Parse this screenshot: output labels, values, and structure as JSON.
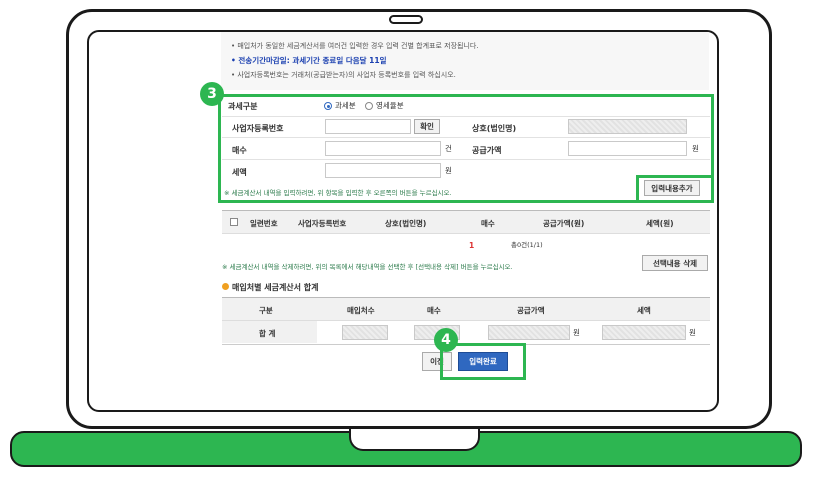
{
  "notes": {
    "line1": "• 매입처가 동일한 세금계산서를 여러건 입력한 경우 입력 건별 합계표로 저장됩니다.",
    "line2": "• 전송기간마감일: 과세기간 종료일 다음달 11일",
    "line3": "• 사업자등록번호는 거래처(공급받는자)의 사업자 등록번호를 입력 하십시오."
  },
  "steps": {
    "step3": "3",
    "step4": "4"
  },
  "form": {
    "tax_type_label": "과세구분",
    "tax_option_taxable": "과세분",
    "tax_option_zero": "영세율분",
    "biz_no_label": "사업자등록번호",
    "confirm_button": "확인",
    "trade_name_label": "상호(법인명)",
    "count_label": "매수",
    "count_unit": "건",
    "supply_label": "공급가액",
    "supply_unit": "원",
    "tax_label": "세액",
    "tax_unit": "원",
    "hint": "※ 세금계산서 내역을 입력하려면, 위 항목을 입력한 후 오른쪽의 버튼을 누르십시오.",
    "add_button": "입력내용추가"
  },
  "list": {
    "columns": [
      "일련번호",
      "사업자등록번호",
      "상호(법인명)",
      "매수",
      "공급가액(원)",
      "세액(원)"
    ],
    "page_marker": "1",
    "total_text": "총0건(1/1)",
    "delete_hint": "※ 세금계산서 내역을 삭제하려면, 위의 목록에서 해당내역을 선택한 후 [선택내용 삭제] 버튼을 누르십시오.",
    "delete_button": "선택내용 삭제"
  },
  "summary": {
    "title": "매입처별 세금계산서 합계",
    "columns": [
      "구분",
      "매입처수",
      "매수",
      "공급가액",
      "세액"
    ],
    "row_label": "합 계",
    "won": "원"
  },
  "footer": {
    "prev_button": "이전",
    "complete_button": "입력완료"
  },
  "colors": {
    "accent_green": "#2db651",
    "primary_blue": "#2f68c0"
  }
}
